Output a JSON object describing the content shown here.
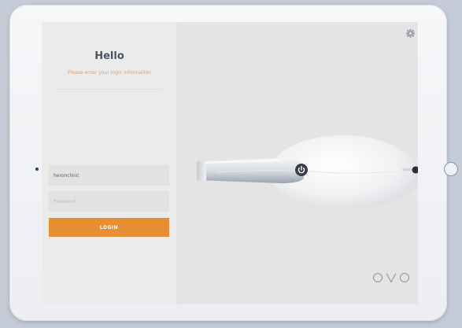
{
  "login": {
    "title": "Hello",
    "subtitle": "Please enter your login information",
    "username_value": "heronclinic",
    "password_placeholder": "Password",
    "login_label": "LOGIN"
  },
  "icons": {
    "settings": "gear-icon",
    "power": "power-icon",
    "logo": "ovo-logo"
  },
  "colors": {
    "accent": "#e98f33",
    "subtitle": "#e8a060",
    "title": "#4a5563"
  }
}
